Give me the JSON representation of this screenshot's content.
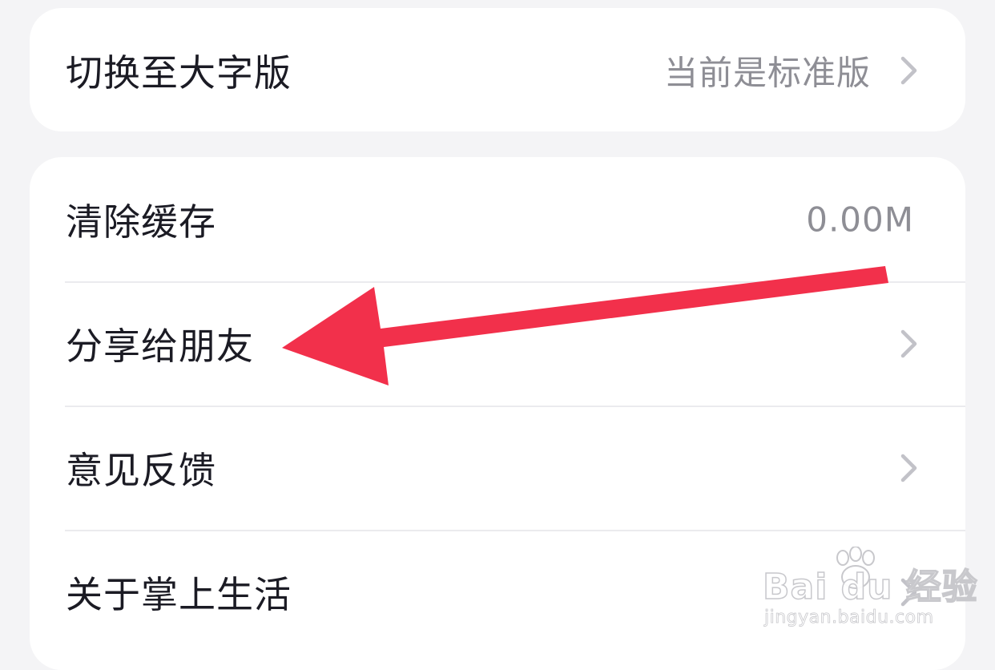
{
  "settings": {
    "display_mode": {
      "label": "切换至大字版",
      "value": "当前是标准版"
    },
    "items": [
      {
        "label": "清除缓存",
        "value": "0.00M"
      },
      {
        "label": "分享给朋友"
      },
      {
        "label": "意见反馈"
      },
      {
        "label": "关于掌上生活"
      }
    ]
  },
  "watermark": {
    "logo_text": "Bai du 经验",
    "url": "jingyan.baidu.com"
  },
  "colors": {
    "background": "#f4f4f6",
    "card": "#ffffff",
    "label_text": "#1b1b24",
    "value_text": "#8e8e95",
    "chevron": "#c2c2c8",
    "annotation_arrow": "#f2304b"
  },
  "icons": {
    "chevron": "chevron-right-icon",
    "annotation": "red-arrow-annotation"
  }
}
